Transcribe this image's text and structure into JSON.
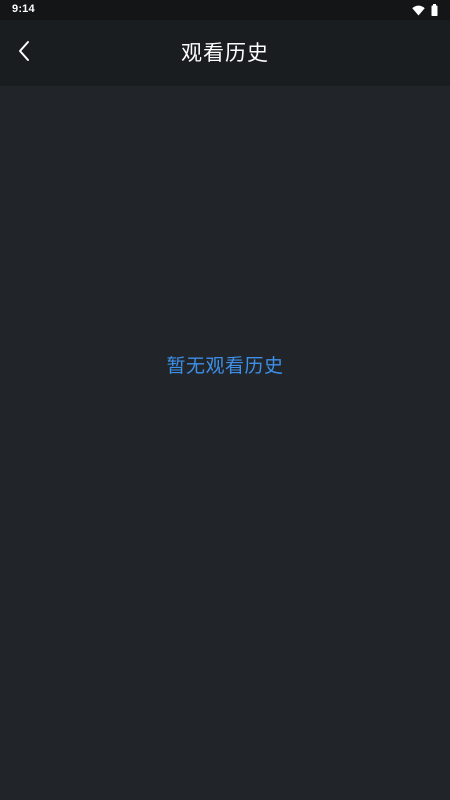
{
  "status_bar": {
    "time": "9:14",
    "icons": [
      "wifi-icon",
      "battery-icon"
    ]
  },
  "header": {
    "back_icon": "chevron-left-icon",
    "title": "观看历史"
  },
  "main": {
    "empty_message": "暂无观看历史"
  },
  "colors": {
    "background": "#212529",
    "header_background": "#1a1d20",
    "status_bar_background": "#131517",
    "accent": "#3d8fe8",
    "title_text": "#ffffff"
  }
}
